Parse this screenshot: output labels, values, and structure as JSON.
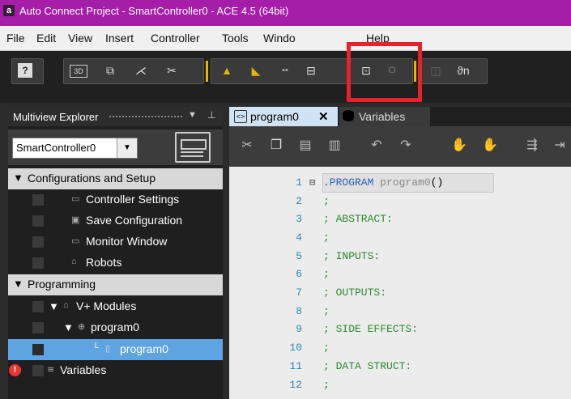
{
  "window": {
    "title": "Auto Connect Project - SmartController0 - ACE 4.5 (64bit)",
    "app_icon": "a"
  },
  "menu": [
    "File",
    "Edit",
    "View",
    "Insert",
    "Controller",
    "Tools",
    "Windo",
    "Help"
  ],
  "explorer": {
    "title": "Multiview Explorer",
    "controller_select": "SmartController0",
    "items": [
      {
        "label": "Configurations and Setup"
      },
      {
        "label": "Controller Settings"
      },
      {
        "label": "Save Configuration"
      },
      {
        "label": "Monitor Window"
      },
      {
        "label": "Robots"
      },
      {
        "label": "Programming"
      },
      {
        "label": "V+ Modules"
      },
      {
        "label": "program0"
      },
      {
        "label": "program0"
      },
      {
        "label": "Variables"
      }
    ],
    "error_badge": "!"
  },
  "editor": {
    "tabs": [
      {
        "label": "program0"
      },
      {
        "label": "Variables"
      }
    ],
    "lines": [
      {
        "n": "1",
        "kw": ".PROGRAM",
        "rest": " program0",
        "paren": "()"
      },
      {
        "n": "2",
        "text": ";"
      },
      {
        "n": "3",
        "text": "; ABSTRACT:"
      },
      {
        "n": "4",
        "text": ";"
      },
      {
        "n": "5",
        "text": "; INPUTS:"
      },
      {
        "n": "6",
        "text": ";"
      },
      {
        "n": "7",
        "text": "; OUTPUTS:"
      },
      {
        "n": "8",
        "text": ";"
      },
      {
        "n": "9",
        "text": "; SIDE EFFECTS:"
      },
      {
        "n": "10",
        "text": ";"
      },
      {
        "n": "11",
        "text": "; DATA STRUCT:"
      },
      {
        "n": "12",
        "text": ";"
      }
    ]
  },
  "colors": {
    "titlebar": "#a51ea8",
    "highlight": "#e5232c",
    "selected": "#5ea4e0"
  }
}
